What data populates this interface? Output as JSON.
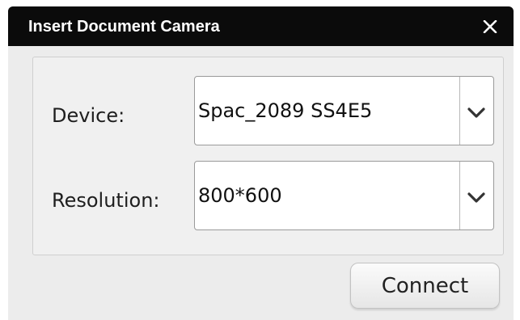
{
  "dialog": {
    "title": "Insert Document Camera",
    "close_icon": "close-icon"
  },
  "form": {
    "device": {
      "label": "Device:",
      "value": "Spac_2089 SS4E5",
      "dropdown_icon": "chevron-down-icon"
    },
    "resolution": {
      "label": "Resolution:",
      "value": "800*600",
      "dropdown_icon": "chevron-down-icon"
    }
  },
  "actions": {
    "connect_label": "Connect"
  },
  "colors": {
    "titlebar": "#0b0b0b",
    "title_text": "#ffffff",
    "dialog_background": "#ececec"
  }
}
